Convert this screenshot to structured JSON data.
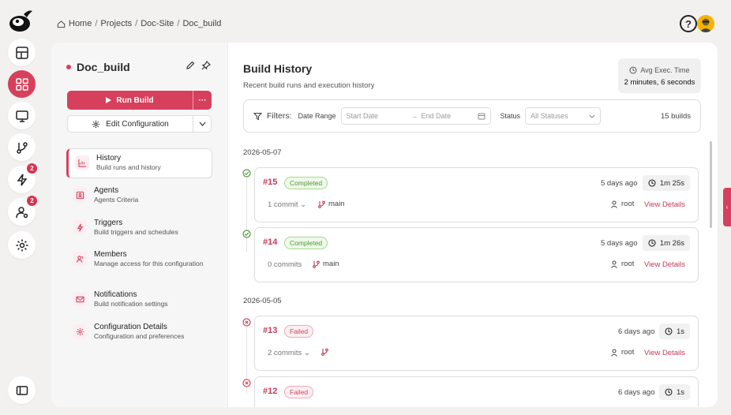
{
  "breadcrumb": {
    "items": [
      "Home",
      "Projects",
      "Doc-Site",
      "Doc_build"
    ],
    "separator": "/"
  },
  "rail": {
    "items": [
      {
        "name": "dashboard-icon"
      },
      {
        "name": "apps-icon",
        "active": true
      },
      {
        "name": "monitor-icon"
      },
      {
        "name": "git-branch-icon"
      },
      {
        "name": "lightning-icon",
        "badge": "2"
      },
      {
        "name": "user-settings-icon",
        "badge": "2"
      },
      {
        "name": "gear-icon"
      }
    ]
  },
  "project": {
    "name": "Doc_build"
  },
  "actions": {
    "run_label": "Run Build",
    "more_label": "···",
    "edit_config_label": "Edit Configuration"
  },
  "nav": [
    {
      "title": "History",
      "subtitle": "Build runs and history",
      "icon": "chart-icon"
    },
    {
      "title": "Agents",
      "subtitle": "Agents Criteria",
      "icon": "agent-icon"
    },
    {
      "title": "Triggers",
      "subtitle": "Build triggers and schedules",
      "icon": "lightning-icon"
    },
    {
      "title": "Members",
      "subtitle": "Manage access for this configuration",
      "icon": "users-icon"
    },
    {
      "title": "Notifications",
      "subtitle": "Build notification settings",
      "icon": "mail-icon"
    },
    {
      "title": "Configuration Details",
      "subtitle": "Configuration and preferences",
      "icon": "gear-icon"
    }
  ],
  "header": {
    "title": "Build History",
    "subtitle": "Recent build runs and execution history"
  },
  "avg": {
    "label": "Avg Exec. Time",
    "value": "2 minutes, 6 seconds"
  },
  "filters": {
    "label": "Filters:",
    "date_range_label": "Date Range",
    "start_placeholder": "Start Date",
    "arrow": "→",
    "end_placeholder": "End Date",
    "status_label": "Status",
    "status_value": "All Statuses",
    "count": "15 builds"
  },
  "groups": [
    {
      "date": "2026-05-07",
      "builds": [
        {
          "id": "#15",
          "status": "Completed",
          "ago": "5 days ago",
          "duration": "1m 25s",
          "commits": "1 commit",
          "branch": "main",
          "user": "root",
          "link": "View Details"
        },
        {
          "id": "#14",
          "status": "Completed",
          "ago": "5 days ago",
          "duration": "1m 26s",
          "commits": "0 commits",
          "branch": "main",
          "user": "root",
          "link": "View Details"
        }
      ]
    },
    {
      "date": "2026-05-05",
      "builds": [
        {
          "id": "#13",
          "status": "Failed",
          "ago": "6 days ago",
          "duration": "1s",
          "commits": "2 commits",
          "branch": "",
          "user": "root",
          "link": "View Details"
        },
        {
          "id": "#12",
          "status": "Failed",
          "ago": "6 days ago",
          "duration": "1s",
          "commits": "",
          "branch": "",
          "user": "",
          "link": ""
        }
      ]
    }
  ],
  "colors": {
    "accent": "#d6405c",
    "success": "#4f9a35",
    "danger": "#d6405c"
  }
}
